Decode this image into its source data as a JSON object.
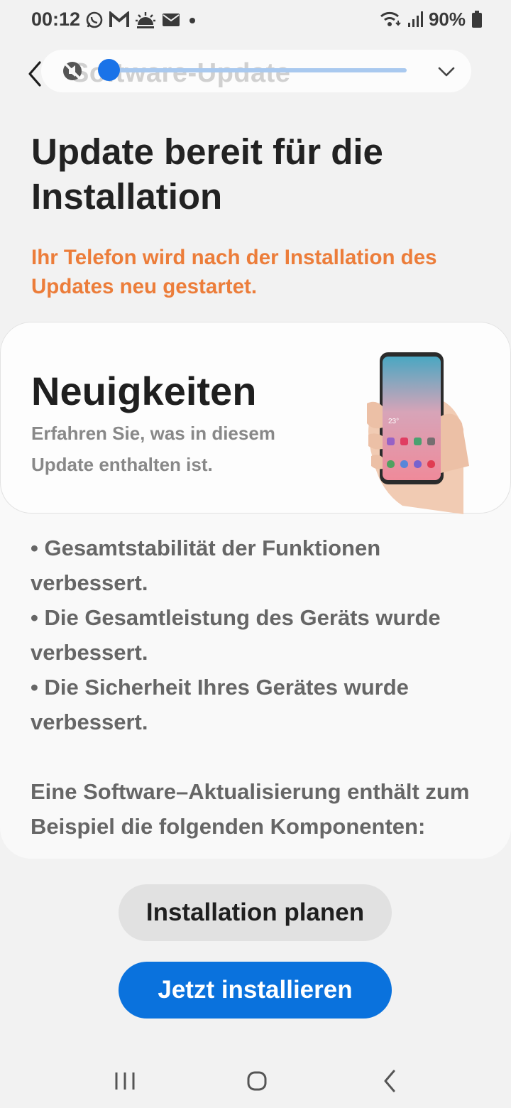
{
  "status_bar": {
    "time": "00:12",
    "battery": "90%",
    "icons": [
      "whatsapp-icon",
      "gmail-icon",
      "weather-icon",
      "mail-icon",
      "dot-icon",
      "wifi-icon",
      "signal-icon",
      "battery-icon"
    ]
  },
  "top_bar": {
    "title": "Software-Update",
    "seek_progress": 0.02
  },
  "main": {
    "heading": "Update bereit für die Installation",
    "warning": "Ihr Telefon wird nach der Installation des Updates neu gestartet."
  },
  "card": {
    "title": "Neuigkeiten",
    "subtitle": "Erfahren Sie, was in diesem Update enthalten ist.",
    "phone_time": "23°",
    "notes": [
      "• Gesamtstabilität der Funktionen verbessert.",
      "• Die Gesamtleistung des Geräts wurde verbessert.",
      "• Die Sicherheit Ihres Gerätes wurde verbessert."
    ],
    "note_extra": "Eine Software–Aktualisierung enthält zum Beispiel die folgenden Komponenten:"
  },
  "buttons": {
    "plan": "Installation planen",
    "install": "Jetzt installieren"
  },
  "colors": {
    "accent": "#0a72dd",
    "warning": "#ec7d3a",
    "seek": "#1a73e8"
  }
}
